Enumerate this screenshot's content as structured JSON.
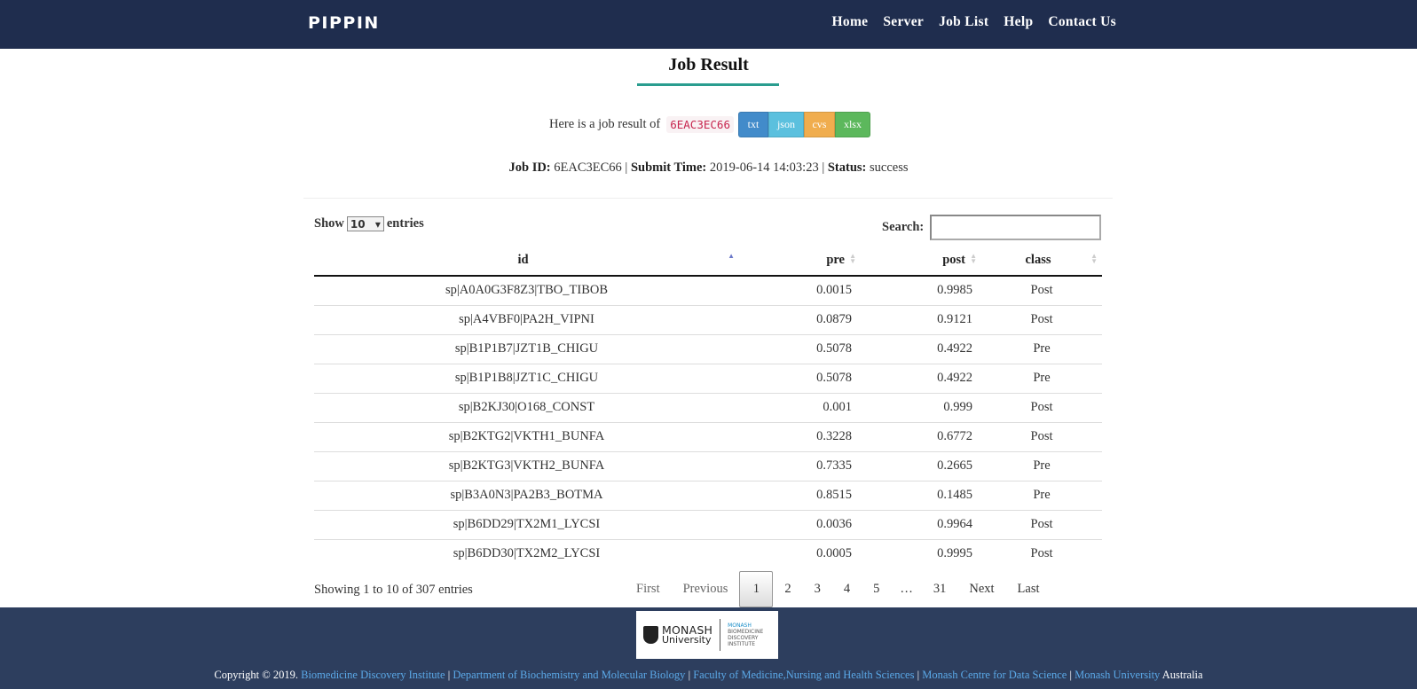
{
  "navbar": {
    "brand": "PIPPIN",
    "links": [
      "Home",
      "Server",
      "Job List",
      "Help",
      "Contact Us"
    ]
  },
  "page_title": "Job Result",
  "result": {
    "intro": "Here is a job result of",
    "job_code": "6EAC3EC66",
    "downloads": [
      "txt",
      "json",
      "cvs",
      "xlsx"
    ]
  },
  "meta": {
    "job_id_label": "Job ID:",
    "job_id": "6EAC3EC66",
    "submit_time_label": "Submit Time:",
    "submit_time": "2019-06-14 14:03:23",
    "status_label": "Status:",
    "status": "success",
    "separator": "|"
  },
  "controls": {
    "show_label": "Show",
    "entries_label": "entries",
    "page_length": "10",
    "search_label": "Search:",
    "search_value": ""
  },
  "table": {
    "headers": [
      "id",
      "pre",
      "post",
      "class"
    ],
    "rows": [
      [
        "sp|A0A0G3F8Z3|TBO_TIBOB",
        "0.0015",
        "0.9985",
        "Post"
      ],
      [
        "sp|A4VBF0|PA2H_VIPNI",
        "0.0879",
        "0.9121",
        "Post"
      ],
      [
        "sp|B1P1B7|JZT1B_CHIGU",
        "0.5078",
        "0.4922",
        "Pre"
      ],
      [
        "sp|B1P1B8|JZT1C_CHIGU",
        "0.5078",
        "0.4922",
        "Pre"
      ],
      [
        "sp|B2KJ30|O168_CONST",
        "0.001",
        "0.999",
        "Post"
      ],
      [
        "sp|B2KTG2|VKTH1_BUNFA",
        "0.3228",
        "0.6772",
        "Post"
      ],
      [
        "sp|B2KTG3|VKTH2_BUNFA",
        "0.7335",
        "0.2665",
        "Pre"
      ],
      [
        "sp|B3A0N3|PA2B3_BOTMA",
        "0.8515",
        "0.1485",
        "Pre"
      ],
      [
        "sp|B6DD29|TX2M1_LYCSI",
        "0.0036",
        "0.9964",
        "Post"
      ],
      [
        "sp|B6DD30|TX2M2_LYCSI",
        "0.0005",
        "0.9995",
        "Post"
      ]
    ]
  },
  "info": "Showing 1 to 10 of 307 entries",
  "pagination": {
    "first": "First",
    "previous": "Previous",
    "pages": [
      "1",
      "2",
      "3",
      "4",
      "5"
    ],
    "ellipsis": "…",
    "last_page": "31",
    "next": "Next",
    "last": "Last",
    "current": "1"
  },
  "footer": {
    "logo_monash": "MONASH",
    "logo_university": "University",
    "logo_bdi": [
      "MONASH",
      "BIOMEDICINE",
      "DISCOVERY",
      "INSTITUTE"
    ],
    "copyright": "Copyright © 2019.",
    "links": [
      "Biomedicine Discovery Institute",
      "Department of Biochemistry and Molecular Biology",
      "Faculty of Medicine,Nursing and Health Sciences",
      "Monash Centre for Data Science",
      "Monash University"
    ],
    "separator": "|",
    "suffix": "Australia"
  }
}
